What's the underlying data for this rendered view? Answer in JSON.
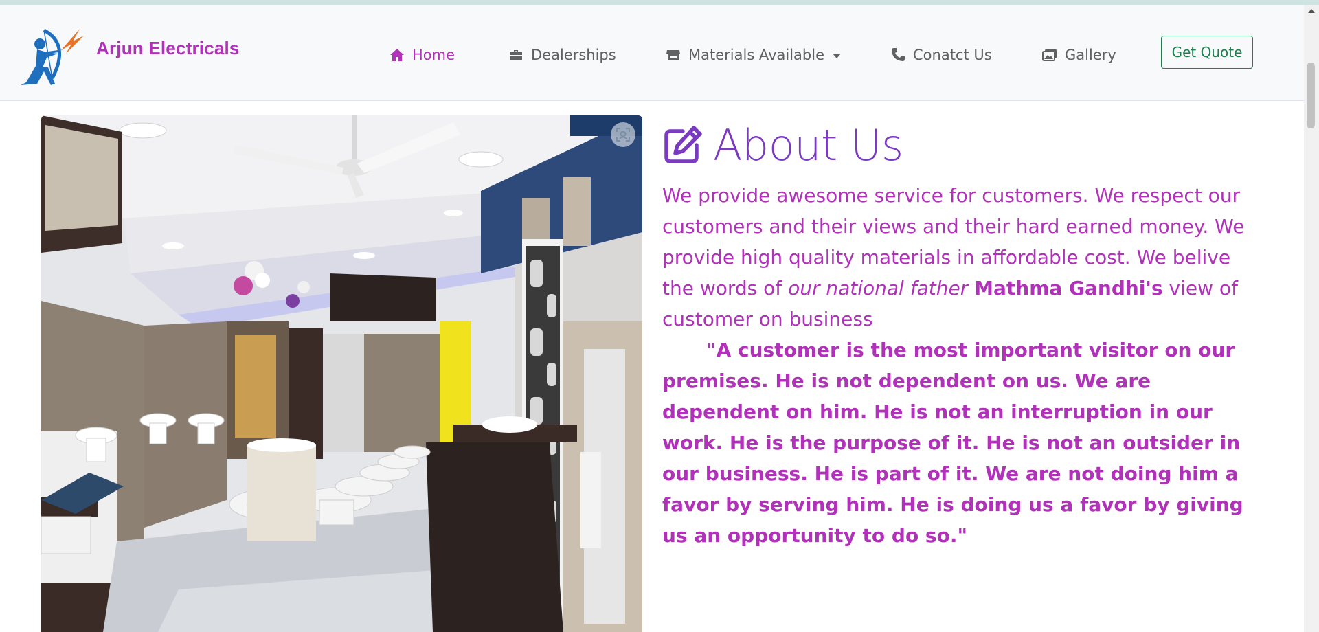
{
  "brand": {
    "name": "Arjun Electricals",
    "logo_icon": "archer-logo-icon"
  },
  "nav": {
    "items": [
      {
        "label": "Home",
        "icon": "home-icon",
        "active": true
      },
      {
        "label": "Dealerships",
        "icon": "briefcase-icon"
      },
      {
        "label": "Materials Available",
        "icon": "store-icon",
        "dropdown": true
      },
      {
        "label": "Conatct Us",
        "icon": "phone-icon"
      },
      {
        "label": "Gallery",
        "icon": "images-icon"
      }
    ],
    "quote_button": "Get Quote"
  },
  "about": {
    "title": "About Us",
    "para_part1": "We provide awesome service for customers. We respect our customers and their views and their hard earned money. We provide high quality materials in affordable cost. We belive the words of ",
    "para_italic": "our national father",
    "para_bold": "Mathma Gandhi's",
    "para_part2": " view of customer on business",
    "quote": "\"A customer is the most important visitor on our premises. He is not dependent on us. We are dependent on him. He is not an interruption in our work. He is the purpose of it. He is not an outsider in our business. He is part of it. We are not doing him a favor by serving him. He is doing us a favor by giving us an opportunity to do so.\""
  },
  "colors": {
    "brand": "#b032b8",
    "title": "#7a3bc0",
    "nav_text": "#616161",
    "quote_button": "#1e7f4e",
    "navbar_bg": "#f8f9fa"
  }
}
